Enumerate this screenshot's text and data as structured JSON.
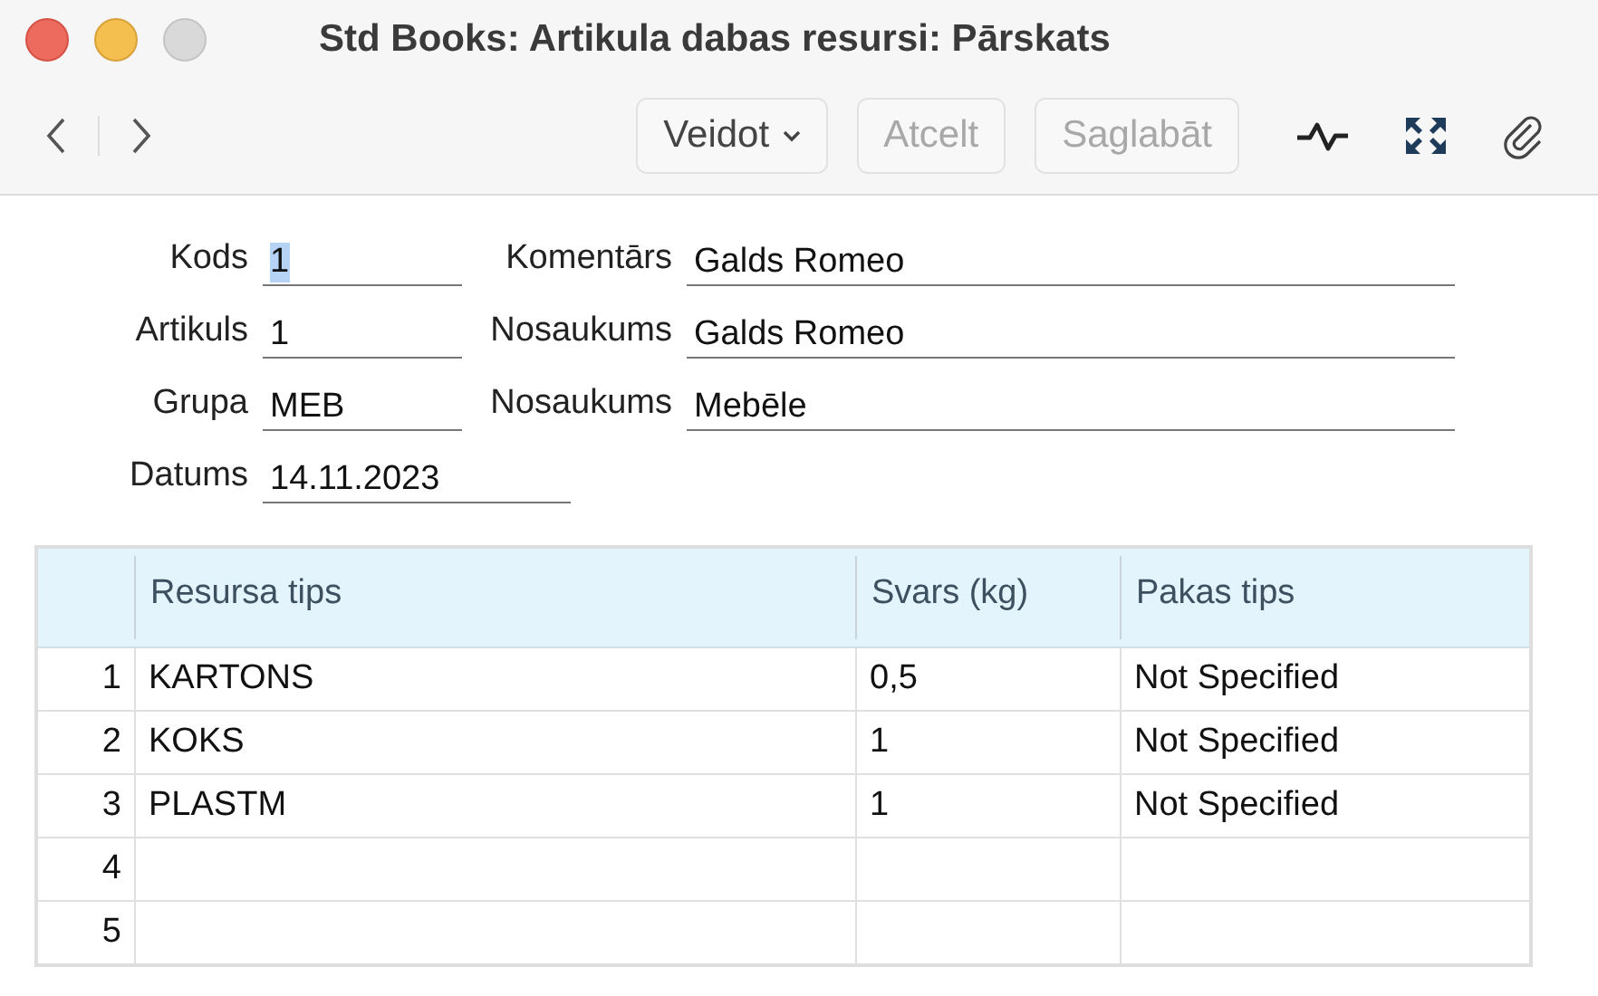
{
  "window": {
    "title": "Std Books: Artikula dabas resursi: Pārskats"
  },
  "toolbar": {
    "buttons": [
      {
        "label": "Veidot",
        "kind": "menu",
        "disabled": false
      },
      {
        "label": "Atcelt",
        "kind": "plain",
        "disabled": true
      },
      {
        "label": "Saglabāt",
        "kind": "plain",
        "disabled": true
      }
    ]
  },
  "form": {
    "rows": [
      {
        "label": "Kods",
        "value": "1",
        "value_selected": true,
        "second_label": "Komentārs",
        "second_value": "Galds Romeo"
      },
      {
        "label": "Artikuls",
        "value": "1",
        "value_selected": false,
        "second_label": "Nosaukums",
        "second_value": "Galds Romeo"
      },
      {
        "label": "Grupa",
        "value": "MEB",
        "value_selected": false,
        "second_label": "Nosaukums",
        "second_value": "Mebēle"
      },
      {
        "label": "Datums",
        "value": "14.11.2023",
        "value_selected": false,
        "kind": "wide"
      }
    ]
  },
  "table": {
    "columns": [
      "Resursa tips",
      "Svars (kg)",
      "Pakas tips"
    ],
    "rows": [
      {
        "number": "1",
        "cells": [
          "KARTONS",
          "0,5",
          "Not Specified"
        ]
      },
      {
        "number": "2",
        "cells": [
          "KOKS",
          "1",
          "Not Specified"
        ]
      },
      {
        "number": "3",
        "cells": [
          "PLASTM",
          "1",
          "Not Specified"
        ]
      },
      {
        "number": "4",
        "cells": []
      },
      {
        "number": "5",
        "cells": []
      }
    ]
  }
}
